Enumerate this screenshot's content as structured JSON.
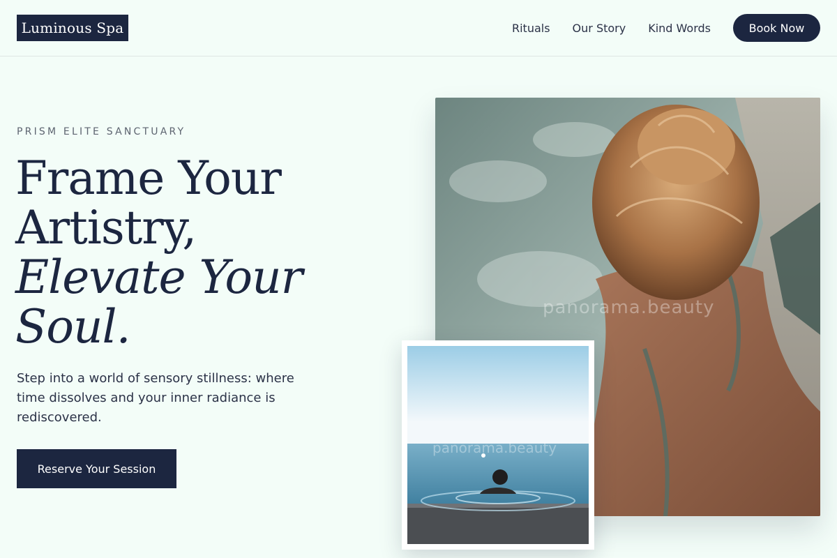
{
  "header": {
    "logo": "Luminous Spa",
    "nav": [
      "Rituals",
      "Our Story",
      "Kind Words"
    ],
    "cta": "Book Now"
  },
  "hero": {
    "eyebrow": "PRISM ELITE SANCTUARY",
    "headline_lines": [
      "Frame Your",
      "Artistry,"
    ],
    "headline_italic_lines": [
      "Elevate Your",
      "Soul."
    ],
    "subtitle": "Step into a world of sensory stillness: where time dissolves and your inner radiance is rediscovered.",
    "cta": "Reserve Your Session"
  },
  "images": {
    "main_watermark": "panorama.beauty",
    "inset_watermark": "panorama.beauty"
  },
  "colors": {
    "background": "#f3fdf8",
    "primary": "#1c2640",
    "text": "#2b3247",
    "muted": "#5d6470"
  }
}
